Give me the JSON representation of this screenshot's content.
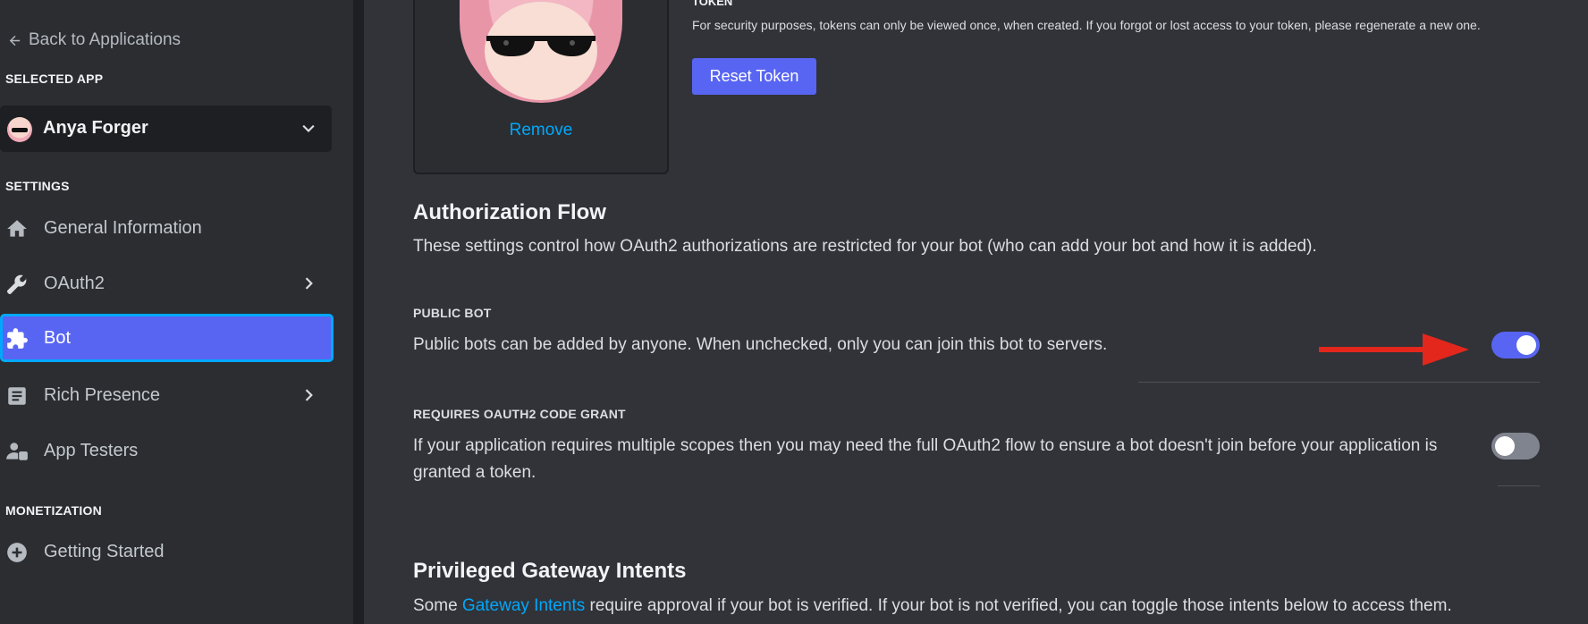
{
  "sidebar": {
    "back_label": "Back to Applications",
    "selected_app_heading": "SELECTED APP",
    "selected_app_name": "Anya Forger",
    "settings_heading": "SETTINGS",
    "items": [
      {
        "label": "General Information",
        "icon": "home-icon",
        "chevron": false,
        "active": false
      },
      {
        "label": "OAuth2",
        "icon": "wrench-icon",
        "chevron": true,
        "active": false
      },
      {
        "label": "Bot",
        "icon": "puzzle-icon",
        "chevron": false,
        "active": true
      },
      {
        "label": "Rich Presence",
        "icon": "document-icon",
        "chevron": true,
        "active": false
      },
      {
        "label": "App Testers",
        "icon": "user-phone-icon",
        "chevron": false,
        "active": false
      }
    ],
    "monetization_heading": "MONETIZATION",
    "monetization_items": [
      {
        "label": "Getting Started",
        "icon": "plus-circle-icon"
      }
    ]
  },
  "avatar": {
    "remove_label": "Remove"
  },
  "token": {
    "label": "TOKEN",
    "note": "For security purposes, tokens can only be viewed once, when created. If you forgot or lost access to your token, please regenerate a new one.",
    "reset_label": "Reset Token"
  },
  "auth_flow": {
    "title": "Authorization Flow",
    "description": "These settings control how OAuth2 authorizations are restricted for your bot (who can add your bot and how it is added).",
    "public_bot": {
      "label": "PUBLIC BOT",
      "text": "Public bots can be added by anyone. When unchecked, only you can join this bot to servers.",
      "enabled": true
    },
    "code_grant": {
      "label": "REQUIRES OAUTH2 CODE GRANT",
      "text": "If your application requires multiple scopes then you may need the full OAuth2 flow to ensure a bot doesn't join before your application is granted a token.",
      "enabled": false
    }
  },
  "gateway": {
    "title": "Privileged Gateway Intents",
    "text_before": "Some ",
    "link": "Gateway Intents",
    "text_after": " require approval if your bot is verified. If your bot is not verified, you can toggle those intents below to access them."
  },
  "colors": {
    "accent": "#5865f2",
    "link": "#00a8fc",
    "arrow": "#e3271c",
    "background": "#313338",
    "sidebar": "#2b2d31"
  }
}
